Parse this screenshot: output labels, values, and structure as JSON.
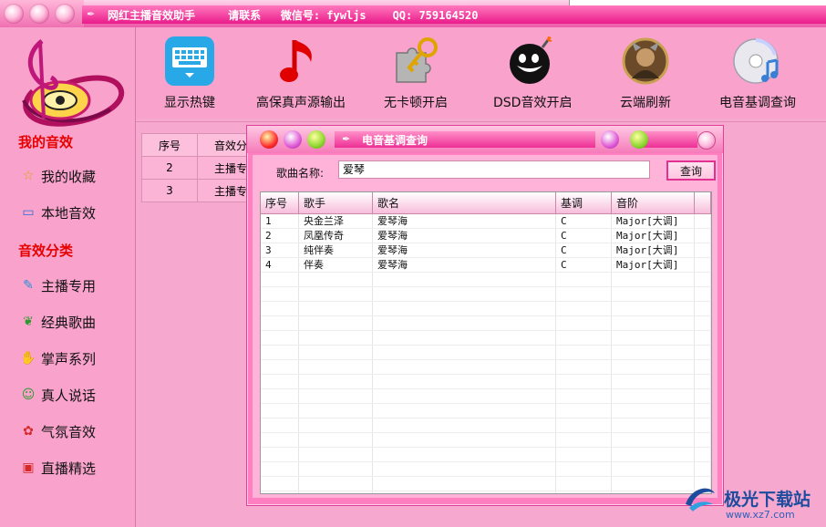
{
  "titlebar": {
    "title": "网红主播音效助手",
    "contact": "请联系",
    "wechat": "微信号: fywljs",
    "qq": "QQ: 759164520"
  },
  "sidebar": {
    "section_my": "我的音效",
    "my_items": [
      {
        "label": "我的收藏",
        "icon": "star-icon"
      },
      {
        "label": "本地音效",
        "icon": "monitor-icon"
      }
    ],
    "section_category": "音效分类",
    "category_items": [
      {
        "label": "主播专用",
        "icon": "microphone-icon"
      },
      {
        "label": "经典歌曲",
        "icon": "leaf-icon"
      },
      {
        "label": "掌声系列",
        "icon": "clap-icon"
      },
      {
        "label": "真人说话",
        "icon": "person-icon"
      },
      {
        "label": "气氛音效",
        "icon": "gift-icon"
      },
      {
        "label": "直播精选",
        "icon": "tv-icon"
      }
    ]
  },
  "toolbar": {
    "items": [
      {
        "label": "显示热键",
        "icon": "keyboard-icon"
      },
      {
        "label": "高保真声源输出",
        "icon": "music-note-icon"
      },
      {
        "label": "无卡顿开启",
        "icon": "puzzle-key-icon"
      },
      {
        "label": "DSD音效开启",
        "icon": "bomb-icon"
      },
      {
        "label": "云端刷新",
        "icon": "game-avatar-icon"
      },
      {
        "label": "电音基调查询",
        "icon": "cd-icon"
      }
    ]
  },
  "background_table": {
    "headers": [
      "序号",
      "音效分"
    ],
    "rows": [
      [
        "2",
        "主播专"
      ],
      [
        "3",
        "主播专"
      ]
    ]
  },
  "dialog": {
    "title": "电音基调查询",
    "song_label": "歌曲名称:",
    "song_value": "爱琴",
    "query_button": "查询",
    "columns": [
      "序号",
      "歌手",
      "歌名",
      "基调",
      "音阶"
    ],
    "rows": [
      [
        "1",
        "央金兰泽",
        "爱琴海",
        "C",
        "Major[大调]"
      ],
      [
        "2",
        "凤凰传奇",
        "爱琴海",
        "C",
        "Major[大调]"
      ],
      [
        "3",
        "纯伴奏",
        "爱琴海",
        "C",
        "Major[大调]"
      ],
      [
        "4",
        "伴奏",
        "爱琴海",
        "C",
        "Major[大调]"
      ]
    ]
  },
  "watermark": {
    "text": "极光下载站",
    "url": "www.xz7.com"
  },
  "colors": {
    "background": "#f7a8cf",
    "titlebar_pink": "#ea1b8b",
    "section_red": "#e60000",
    "dialog_pink": "#ff7fc0"
  }
}
